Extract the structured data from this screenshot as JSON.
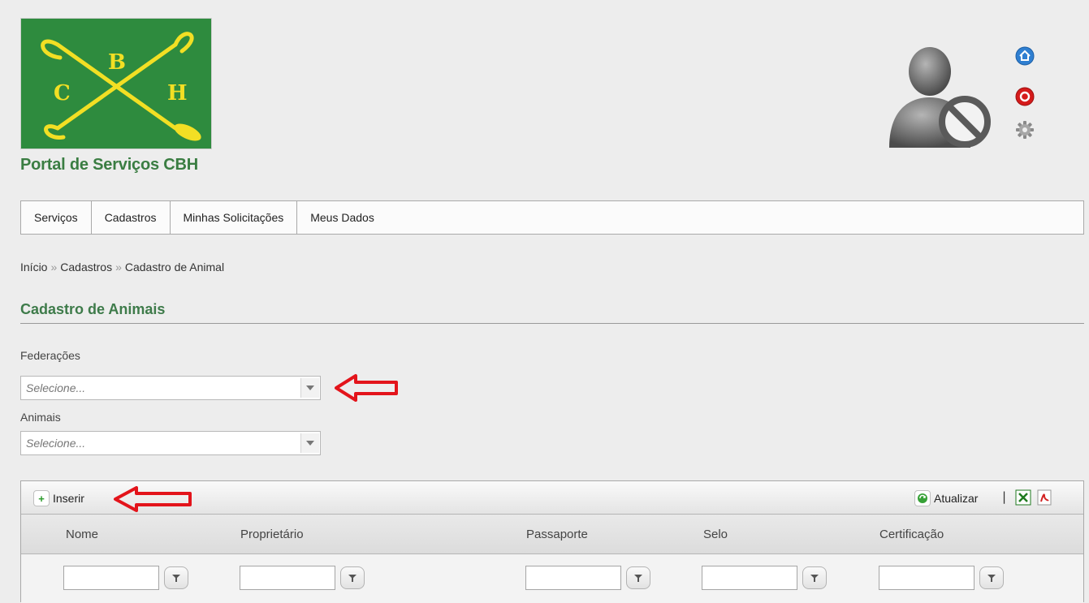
{
  "header": {
    "logo_letters": {
      "top": "B",
      "left": "C",
      "right": "H"
    },
    "site_title": "Portal de Serviços CBH",
    "icons": [
      "home-icon",
      "power-icon",
      "gear-icon"
    ],
    "brand_green": "#2e8b3e",
    "brand_yellow": "#f2df24"
  },
  "nav": {
    "items": [
      {
        "label": "Serviços"
      },
      {
        "label": "Cadastros"
      },
      {
        "label": "Minhas Solicitações"
      },
      {
        "label": "Meus Dados"
      }
    ]
  },
  "breadcrumb": {
    "items": [
      "Início",
      "Cadastros",
      "Cadastro de Animal"
    ],
    "separator": "»"
  },
  "page": {
    "title": "Cadastro de Animais"
  },
  "filters": {
    "federacoes": {
      "label": "Federações",
      "placeholder": "Selecione..."
    },
    "animais": {
      "label": "Animais",
      "placeholder": "Selecione..."
    }
  },
  "grid": {
    "toolbar": {
      "insert_label": "Inserir",
      "refresh_label": "Atualizar",
      "divider": "|"
    },
    "columns": [
      {
        "label": "Nome"
      },
      {
        "label": "Proprietário"
      },
      {
        "label": "Passaporte"
      },
      {
        "label": "Selo"
      },
      {
        "label": "Certificação"
      }
    ]
  },
  "annotation_color": "#e3141b"
}
